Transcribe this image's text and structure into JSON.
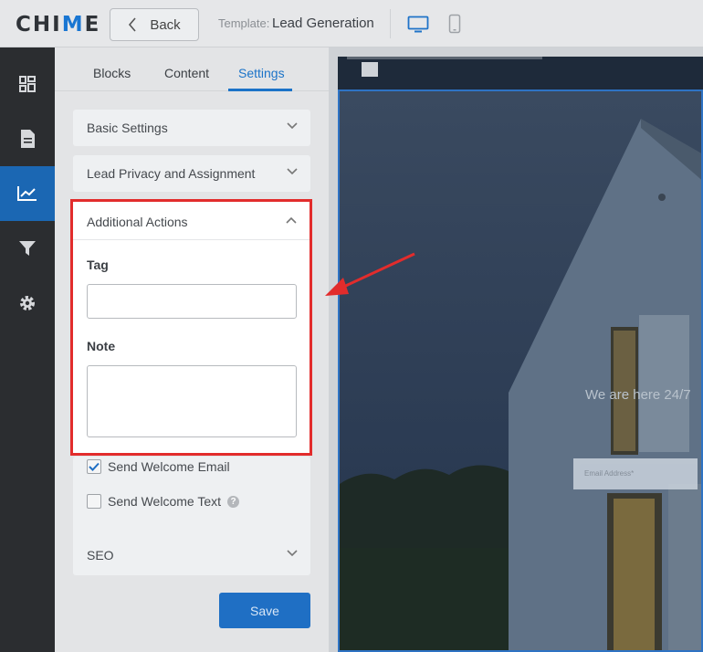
{
  "app": {
    "logo_prefix": "CHI",
    "logo_accent": "M",
    "logo_suffix": "E"
  },
  "header": {
    "back_label": "Back",
    "template_label": "Template:",
    "template_value": "Lead Generation"
  },
  "sidenav": {
    "items": [
      {
        "icon": "grid-icon"
      },
      {
        "icon": "document-icon"
      },
      {
        "icon": "chart-icon",
        "active": true
      },
      {
        "icon": "filter-icon"
      },
      {
        "icon": "gear-icon"
      }
    ]
  },
  "tabs": [
    "Blocks",
    "Content",
    "Settings"
  ],
  "active_tab": "Settings",
  "sections": {
    "basic": "Basic Settings",
    "lead_privacy": "Lead Privacy and Assignment",
    "additional": "Additional Actions",
    "seo": "SEO"
  },
  "additional_actions": {
    "tag_label": "Tag",
    "tag_value": "",
    "note_label": "Note",
    "note_value": ""
  },
  "checkboxes": {
    "welcome_email": {
      "label": "Send Welcome Email",
      "checked": true
    },
    "welcome_text": {
      "label": "Send Welcome Text",
      "checked": false
    }
  },
  "help_glyph": "?",
  "save_label": "Save",
  "preview": {
    "hero_text": "We are here 24/7",
    "email_placeholder": "Email Address*"
  },
  "colors": {
    "accent": "#1976d2",
    "highlight": "#e22c2c",
    "save": "#1f6fc4"
  }
}
